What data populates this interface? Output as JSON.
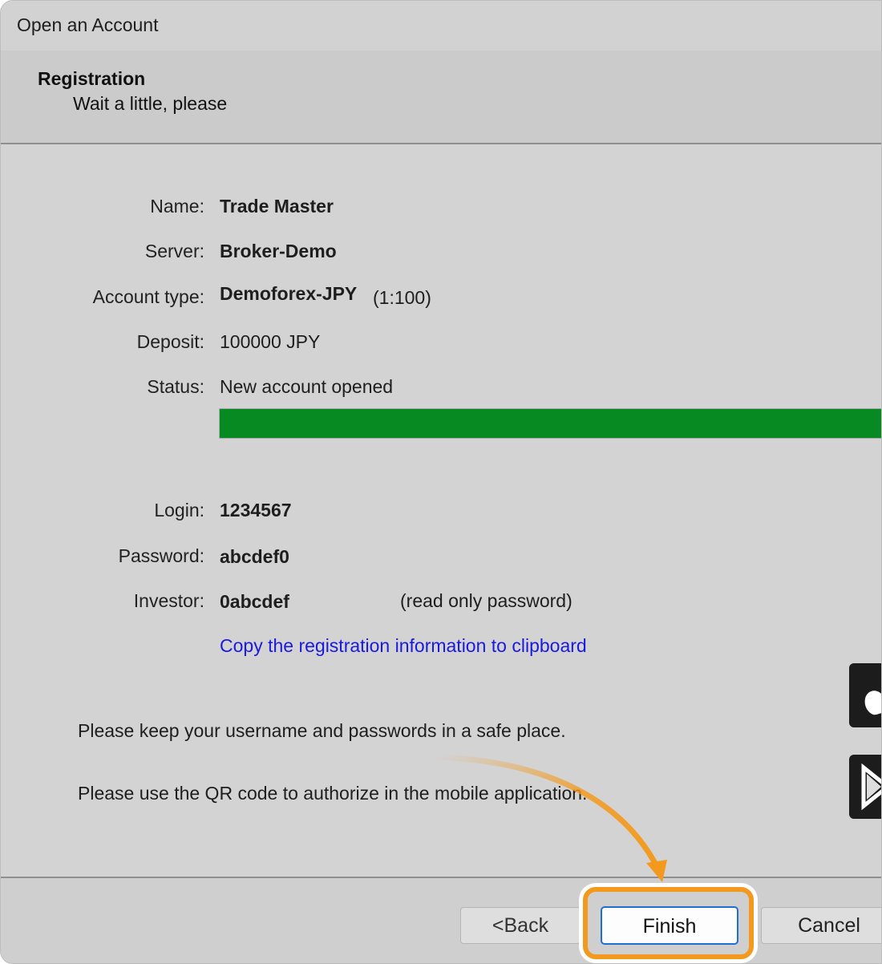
{
  "window": {
    "title": "Open an Account"
  },
  "header": {
    "title": "Registration",
    "subtitle": "Wait a little, please"
  },
  "details": {
    "name": {
      "label": "Name:",
      "value": "Trade Master"
    },
    "server": {
      "label": "Server:",
      "value": "Broker-Demo"
    },
    "account_type": {
      "label": "Account type:",
      "value": "Demoforex-JPY",
      "leverage": "(1:100)"
    },
    "deposit": {
      "label": "Deposit:",
      "value": "100000 JPY"
    },
    "status": {
      "label": "Status:",
      "value": "New account opened",
      "progress_percent": 100,
      "progress_color": "#078a21"
    },
    "login": {
      "label": "Login:",
      "value": "1234567"
    },
    "password": {
      "label": "Password:",
      "value": "abcdef0"
    },
    "investor": {
      "label": "Investor:",
      "value": "0abcdef",
      "note": "(read only password)"
    }
  },
  "copy_link": "Copy the registration information to clipboard",
  "notes": {
    "safe_place": "Please keep your username and passwords in a safe place.",
    "qr_code": "Please use the QR code to authorize in the mobile application."
  },
  "mobile_buttons": [
    {
      "icon": "apple-icon"
    },
    {
      "icon": "google-play-icon"
    }
  ],
  "footer": {
    "back_label": "<Back",
    "finish_label": "Finish",
    "cancel_label": "Cancel"
  },
  "colors": {
    "highlight": "#f39a1e",
    "link": "#1a1adf",
    "focus_border": "#1f6fd0"
  }
}
